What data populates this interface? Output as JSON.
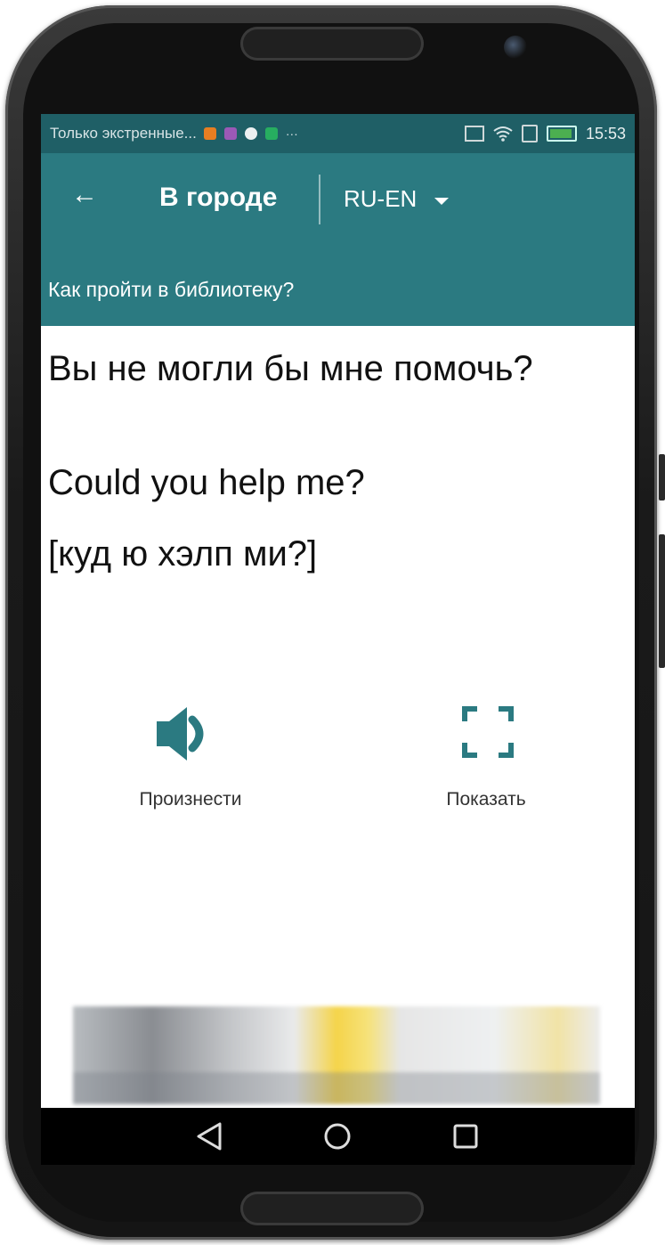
{
  "statusbar": {
    "notification_text": "Только экстренные...",
    "time": "15:53",
    "icons": [
      "app-icon-1",
      "app-icon-2",
      "app-icon-3",
      "app-icon-4",
      "more-icon",
      "nfc-icon",
      "wifi-icon",
      "sim-icon",
      "battery-icon"
    ]
  },
  "toolbar": {
    "title": "В городе",
    "language": "RU-EN"
  },
  "subheader": {
    "question": "Как пройти в библиотеку?"
  },
  "phrase": {
    "ru": "Вы не могли бы мне помочь?",
    "en": "Could you help me?",
    "transcription": "[куд ю хэлп ми?]"
  },
  "actions": {
    "speak_label": "Произнести",
    "show_label": "Показать"
  },
  "colors": {
    "primary": "#2b7a81",
    "statusbar": "#1f5f66",
    "accent_icon": "#2b7a81"
  }
}
